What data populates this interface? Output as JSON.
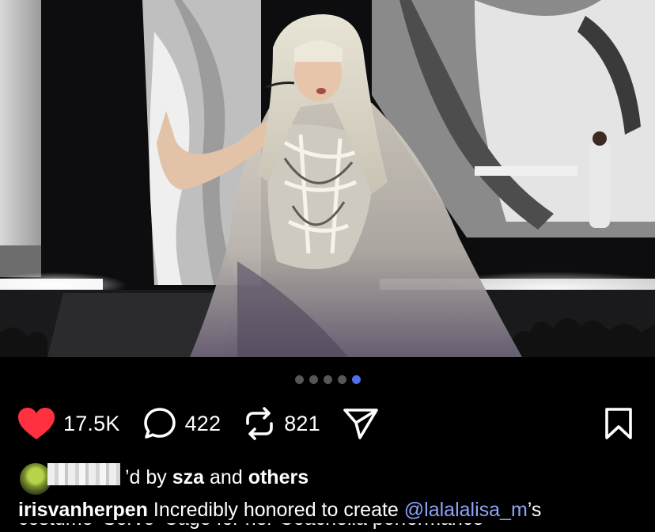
{
  "post": {
    "image_alt": "Performer in a sculptural silver gown on stage",
    "carousel": {
      "total": 5,
      "active": 5
    },
    "likes": "17.5K",
    "comments": "422",
    "reposts": "821",
    "liked_by": {
      "prefix": "’d by",
      "user": "sza",
      "joiner": "and",
      "others": "others"
    },
    "caption": {
      "username": "irisvanherpen",
      "text": "Incredibly honored to create",
      "mention": "@lalalalisa_m",
      "suffix": "’s",
      "next_line_fragment": "costume ‘Serve’ Cage for her Coachella performance"
    },
    "colors": {
      "heart": "#ff3040",
      "active_dot": "#4f6fe8",
      "mention": "#8ea3f8"
    },
    "icons": [
      "heart-icon",
      "comment-icon",
      "repost-icon",
      "share-icon",
      "bookmark-icon"
    ]
  }
}
